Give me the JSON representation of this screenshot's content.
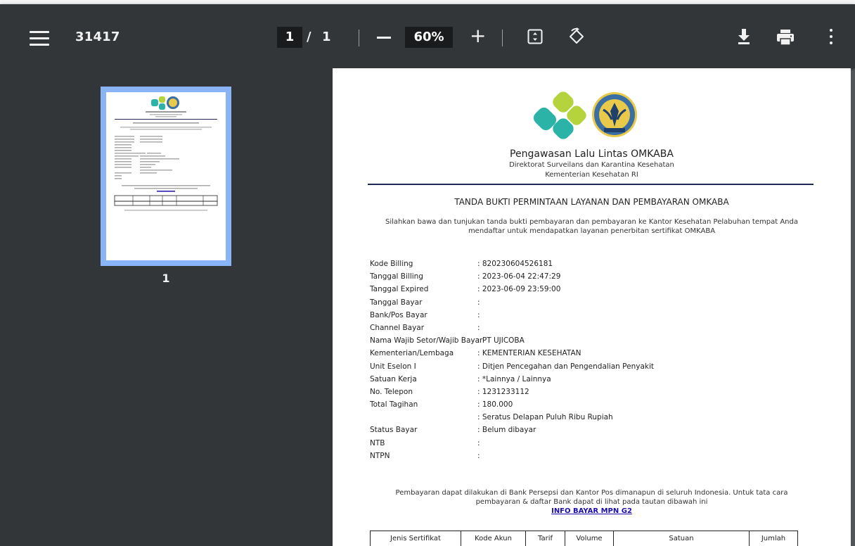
{
  "toolbar": {
    "title": "31417",
    "current_page": "1",
    "page_separator": "/",
    "total_pages": "1",
    "zoom": "60%",
    "zoom_in_symbol": "+",
    "icons": [
      "menu-icon",
      "zoom-out-icon",
      "zoom-in-icon",
      "fit-page-icon",
      "rotate-icon",
      "download-icon",
      "print-icon",
      "more-options-icon"
    ]
  },
  "sidebar": {
    "thumbnail_label": "1"
  },
  "document": {
    "header": {
      "title": "Pengawasan Lalu Lintas OMKABA",
      "line1": "Direktorat Surveilans dan Karantina Kesehatan",
      "line2": "Kementerian Kesehatan RI"
    },
    "heading": "TANDA BUKTI PERMINTAAN LAYANAN DAN PEMBAYARAN OMKABA",
    "intro": "Silahkan bawa dan tunjukan tanda bukti pembayaran dan pembayaran ke Kantor Kesehatan Pelabuhan tempat Anda mendaftar untuk mendapatkan layanan penerbitan sertifikat OMKABA",
    "fields": [
      {
        "label": "Kode Billing",
        "value": ": 820230604526181"
      },
      {
        "label": "Tanggal Billing",
        "value": ": 2023-06-04 22:47:29"
      },
      {
        "label": "Tanggal Expired",
        "value": ": 2023-06-09 23:59:00"
      },
      {
        "label": "Tanggal Bayar",
        "value": ":"
      },
      {
        "label": "Bank/Pos Bayar",
        "value": ":"
      },
      {
        "label": "Channel Bayar",
        "value": ":"
      },
      {
        "label": "Nama Wajib Setor/Wajib Bayar",
        "value": ": PT UJICOBA"
      },
      {
        "label": "Kementerian/Lembaga",
        "value": ": KEMENTERIAN KESEHATAN"
      },
      {
        "label": "Unit Eselon I",
        "value": ": Ditjen Pencegahan dan Pengendalian Penyakit"
      },
      {
        "label": "Satuan Kerja",
        "value": ": *Lainnya / Lainnya"
      },
      {
        "label": "No. Telepon",
        "value": ": 1231233112"
      },
      {
        "label": "Total Tagihan",
        "value": ": 180.000"
      },
      {
        "label": "",
        "value": ": Seratus Delapan Puluh Ribu Rupiah"
      },
      {
        "label": "Status Bayar",
        "value": ": Belum dibayar"
      },
      {
        "label": "NTB",
        "value": ":"
      },
      {
        "label": "NTPN",
        "value": ":"
      }
    ],
    "footnote": "Pembayaran dapat dilakukan di Bank Persepsi dan Kantor Pos dimanapun di seluruh Indonesia. Untuk tata cara pembayaran & daftar Bank dapat di lihat pada tautan dibawah ini",
    "link_text": "INFO BAYAR MPN G2",
    "table_headers": [
      "Jenis Sertifikat",
      "Kode Akun",
      "Tarif",
      "Volume",
      "Satuan",
      "Jumlah"
    ]
  },
  "colors": {
    "toolbar_bg": "#323639",
    "viewer_bg": "#525659",
    "thumbnail_border": "#8ab4f8",
    "header_rule": "#1f2a55",
    "link": "#1a0dab",
    "logo_teal": "#2bb3a8",
    "logo_green": "#b5d33d"
  }
}
